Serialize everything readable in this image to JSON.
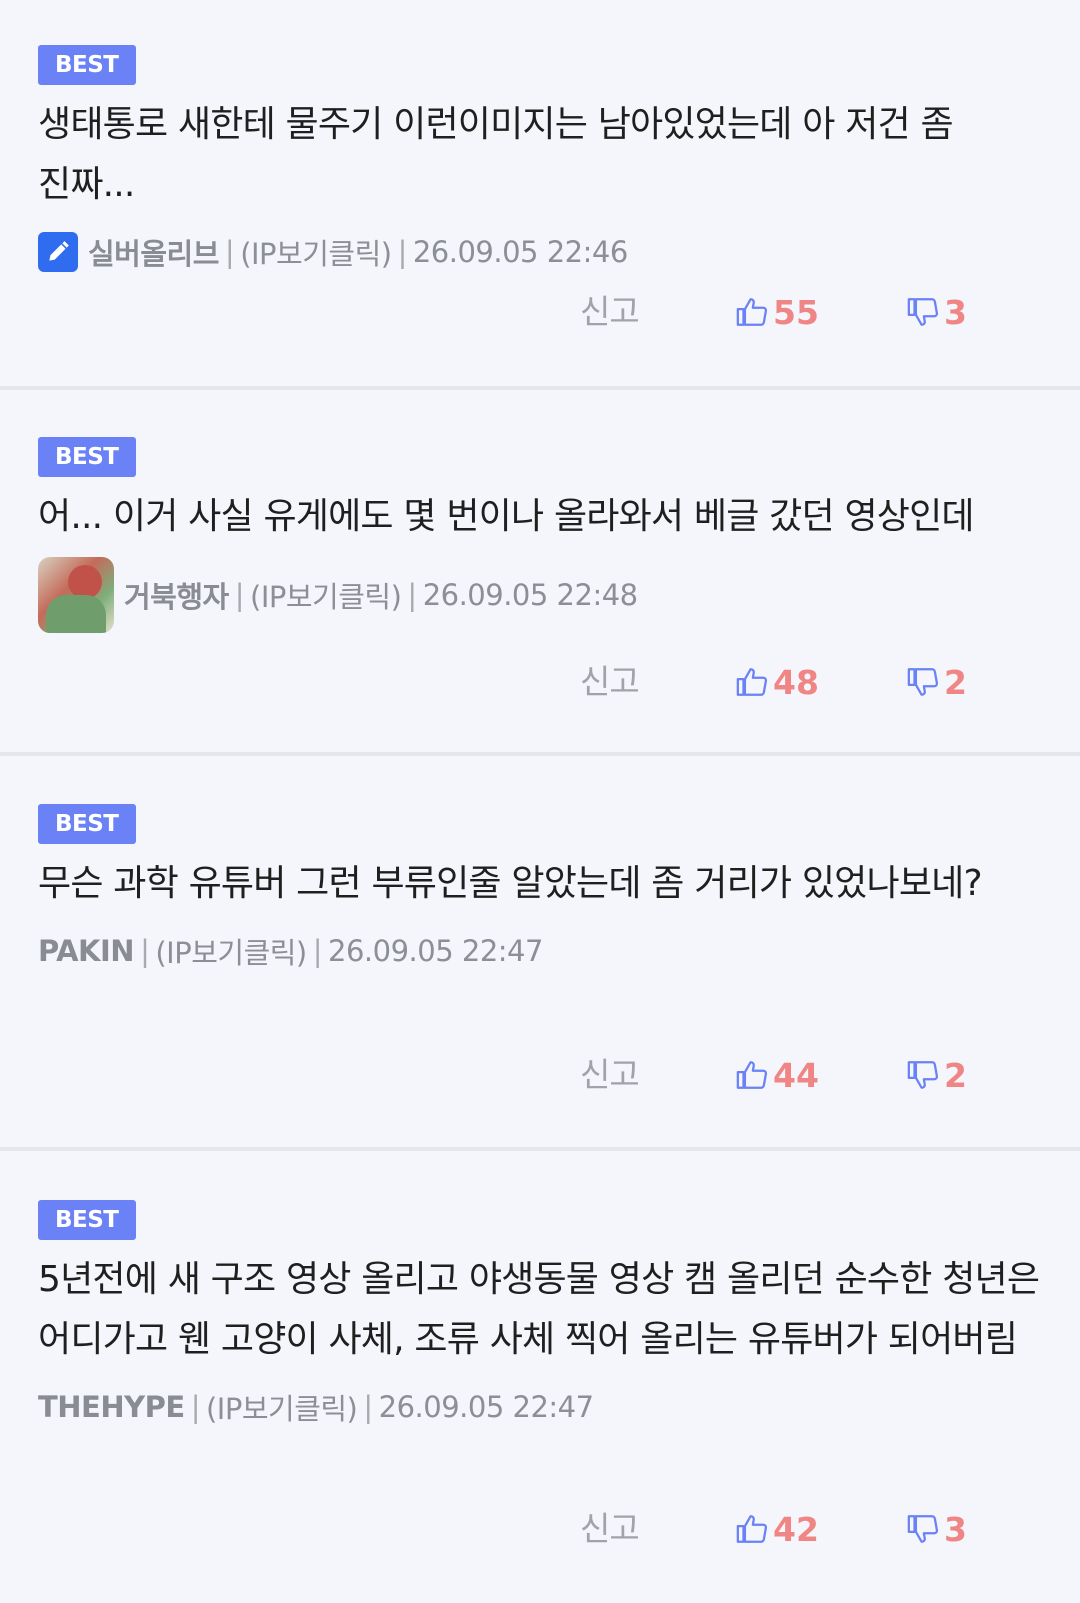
{
  "comments": [
    {
      "badge": "BEST",
      "text": "생태통로 새한테 물주기 이런이미지는 남아있었는데 아 저건 좀 진짜...",
      "author": "실버올리브",
      "author_icon": "pen-icon",
      "ip": "(IP보기클릭)",
      "date": "26.09.05 22:46",
      "report_label": "신고",
      "likes": "55",
      "dislikes": "3"
    },
    {
      "badge": "BEST",
      "text": "어... 이거 사실 유게에도 몇 번이나 올라와서 베글 갔던 영상인데",
      "author": "거북행자",
      "author_icon": "avatar",
      "ip": "(IP보기클릭)",
      "date": "26.09.05 22:48",
      "report_label": "신고",
      "likes": "48",
      "dislikes": "2"
    },
    {
      "badge": "BEST",
      "text": "무슨 과학 유튜버 그런 부류인줄 알았는데 좀 거리가 있었나보네?",
      "author": "PAKIN",
      "author_icon": "",
      "ip": "(IP보기클릭)",
      "date": "26.09.05 22:47",
      "report_label": "신고",
      "likes": "44",
      "dislikes": "2"
    },
    {
      "badge": "BEST",
      "text": "5년전에 새 구조 영상 올리고 야생동물 영상 캠 올리던 순수한 청년은 어디가고 웬 고양이 사체, 조류 사체 찍어 올리는 유튜버가 되어버림",
      "author": "THEHYPE",
      "author_icon": "",
      "ip": "(IP보기클릭)",
      "date": "26.09.05 22:47",
      "report_label": "신고",
      "likes": "42",
      "dislikes": "3"
    }
  ],
  "colors": {
    "badge": "#6a82f5",
    "vote_count": "#f08585",
    "thumb_icon": "#6a82f5",
    "background": "#f5f6fb"
  }
}
